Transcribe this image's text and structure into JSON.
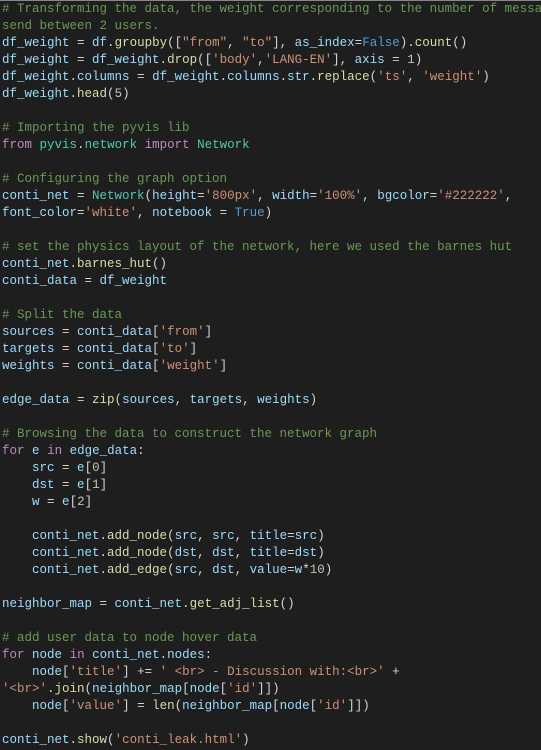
{
  "code": {
    "l01a": "# Transforming the data, the weight corresponding to the number of message",
    "l01b": "send between 2 users.",
    "l02_id1": "df_weight",
    "l02_eq": " = ",
    "l02_id2": "df",
    "l02_dot": ".",
    "l02_fn": "groupby",
    "l02_p1": "([",
    "l02_s1": "\"from\"",
    "l02_c1": ", ",
    "l02_s2": "\"to\"",
    "l02_p2": "], ",
    "l02_kw": "as_index",
    "l02_eq2": "=",
    "l02_false": "False",
    "l02_p3": ").",
    "l02_fn2": "count",
    "l02_p4": "()",
    "l03_id1": "df_weight",
    "l03_eq": " = ",
    "l03_id2": "df_weight",
    "l03_dot": ".",
    "l03_fn": "drop",
    "l03_p1": "([",
    "l03_s1": "'body'",
    "l03_c1": ",",
    "l03_s2": "'LANG-EN'",
    "l03_p2": "], ",
    "l03_kw": "axis",
    "l03_eq2": " = ",
    "l03_n": "1",
    "l03_p3": ")",
    "l04_id1": "df_weight",
    "l04_dot1": ".",
    "l04_id2": "columns",
    "l04_eq": " = ",
    "l04_id3": "df_weight",
    "l04_dot2": ".",
    "l04_id4": "columns",
    "l04_dot3": ".",
    "l04_id5": "str",
    "l04_dot4": ".",
    "l04_fn": "replace",
    "l04_p1": "(",
    "l04_s1": "'ts'",
    "l04_c1": ", ",
    "l04_s2": "'weight'",
    "l04_p2": ")",
    "l05_id": "df_weight",
    "l05_dot": ".",
    "l05_fn": "head",
    "l05_p1": "(",
    "l05_n": "5",
    "l05_p2": ")",
    "l07": "# Importing the pyvis lib",
    "l08_from": "from",
    "l08_sp1": " ",
    "l08_mod": "pyvis",
    "l08_dot": ".",
    "l08_sub": "network",
    "l08_sp2": " ",
    "l08_imp": "import",
    "l08_sp3": " ",
    "l08_cls": "Network",
    "l10": "# Configuring the graph option",
    "l11_id": "conti_net",
    "l11_eq": " = ",
    "l11_cls": "Network",
    "l11_p1": "(",
    "l11_kw1": "height",
    "l11_e1": "=",
    "l11_s1": "'800px'",
    "l11_c1": ", ",
    "l11_kw2": "width",
    "l11_e2": "=",
    "l11_s2": "'100%'",
    "l11_c2": ", ",
    "l11_kw3": "bgcolor",
    "l11_e3": "=",
    "l11_s3": "'#222222'",
    "l11_c3": ",",
    "l12_kw1": "font_color",
    "l12_e1": "=",
    "l12_s1": "'white'",
    "l12_c1": ", ",
    "l12_kw2": "notebook",
    "l12_e2": " = ",
    "l12_true": "True",
    "l12_p": ")",
    "l14": "# set the physics layout of the network, here we used the barnes hut",
    "l15_id": "conti_net",
    "l15_dot": ".",
    "l15_fn": "barnes_hut",
    "l15_p": "()",
    "l16_id1": "conti_data",
    "l16_eq": " = ",
    "l16_id2": "df_weight",
    "l18": "# Split the data",
    "l19_id1": "sources",
    "l19_eq": " = ",
    "l19_id2": "conti_data",
    "l19_p1": "[",
    "l19_s": "'from'",
    "l19_p2": "]",
    "l20_id1": "targets",
    "l20_eq": " = ",
    "l20_id2": "conti_data",
    "l20_p1": "[",
    "l20_s": "'to'",
    "l20_p2": "]",
    "l21_id1": "weights",
    "l21_eq": " = ",
    "l21_id2": "conti_data",
    "l21_p1": "[",
    "l21_s": "'weight'",
    "l21_p2": "]",
    "l23_id1": "edge_data",
    "l23_eq": " = ",
    "l23_fn": "zip",
    "l23_p1": "(",
    "l23_a1": "sources",
    "l23_c1": ", ",
    "l23_a2": "targets",
    "l23_c2": ", ",
    "l23_a3": "weights",
    "l23_p2": ")",
    "l25": "# Browsing the data to construct the network graph",
    "l26_for": "for",
    "l26_sp1": " ",
    "l26_v": "e",
    "l26_sp2": " ",
    "l26_in": "in",
    "l26_sp3": " ",
    "l26_it": "edge_data",
    "l26_col": ":",
    "l27_i": "    ",
    "l27_id": "src",
    "l27_eq": " = ",
    "l27_v": "e",
    "l27_p1": "[",
    "l27_n": "0",
    "l27_p2": "]",
    "l28_i": "    ",
    "l28_id": "dst",
    "l28_eq": " = ",
    "l28_v": "e",
    "l28_p1": "[",
    "l28_n": "1",
    "l28_p2": "]",
    "l29_i": "    ",
    "l29_id": "w",
    "l29_eq": " = ",
    "l29_v": "e",
    "l29_p1": "[",
    "l29_n": "2",
    "l29_p2": "]",
    "l31_i": "    ",
    "l31_id": "conti_net",
    "l31_dot": ".",
    "l31_fn": "add_node",
    "l31_p1": "(",
    "l31_a1": "src",
    "l31_c1": ", ",
    "l31_a2": "src",
    "l31_c2": ", ",
    "l31_kw": "title",
    "l31_eq": "=",
    "l31_a3": "src",
    "l31_p2": ")",
    "l32_i": "    ",
    "l32_id": "conti_net",
    "l32_dot": ".",
    "l32_fn": "add_node",
    "l32_p1": "(",
    "l32_a1": "dst",
    "l32_c1": ", ",
    "l32_a2": "dst",
    "l32_c2": ", ",
    "l32_kw": "title",
    "l32_eq": "=",
    "l32_a3": "dst",
    "l32_p2": ")",
    "l33_i": "    ",
    "l33_id": "conti_net",
    "l33_dot": ".",
    "l33_fn": "add_edge",
    "l33_p1": "(",
    "l33_a1": "src",
    "l33_c1": ", ",
    "l33_a2": "dst",
    "l33_c2": ", ",
    "l33_kw": "value",
    "l33_eq": "=",
    "l33_a3": "w",
    "l33_op": "*",
    "l33_n": "10",
    "l33_p2": ")",
    "l35_id1": "neighbor_map",
    "l35_eq": " = ",
    "l35_id2": "conti_net",
    "l35_dot": ".",
    "l35_fn": "get_adj_list",
    "l35_p": "()",
    "l37": "# add user data to node hover data",
    "l38_for": "for",
    "l38_sp1": " ",
    "l38_v": "node",
    "l38_sp2": " ",
    "l38_in": "in",
    "l38_sp3": " ",
    "l38_id": "conti_net",
    "l38_dot": ".",
    "l38_attr": "nodes",
    "l38_col": ":",
    "l39_i": "    ",
    "l39_id": "node",
    "l39_p1": "[",
    "l39_s1": "'title'",
    "l39_p2": "] ",
    "l39_pe": "+=",
    "l39_sp": " ",
    "l39_s2": "' <br> - Discussion with:<br>'",
    "l39_plus": " +",
    "l40_s": "'<br>'",
    "l40_dot": ".",
    "l40_fn": "join",
    "l40_p1": "(",
    "l40_id1": "neighbor_map",
    "l40_p2": "[",
    "l40_id2": "node",
    "l40_p3": "[",
    "l40_s2": "'id'",
    "l40_p4": "]])",
    "l41_i": "    ",
    "l41_id": "node",
    "l41_p1": "[",
    "l41_s1": "'value'",
    "l41_p2": "] = ",
    "l41_fn": "len",
    "l41_p3": "(",
    "l41_id2": "neighbor_map",
    "l41_p4": "[",
    "l41_id3": "node",
    "l41_p5": "[",
    "l41_s2": "'id'",
    "l41_p6": "]])",
    "l43_id": "conti_net",
    "l43_dot": ".",
    "l43_fn": "show",
    "l43_p1": "(",
    "l43_s": "'conti_leak.html'",
    "l43_p2": ")"
  }
}
